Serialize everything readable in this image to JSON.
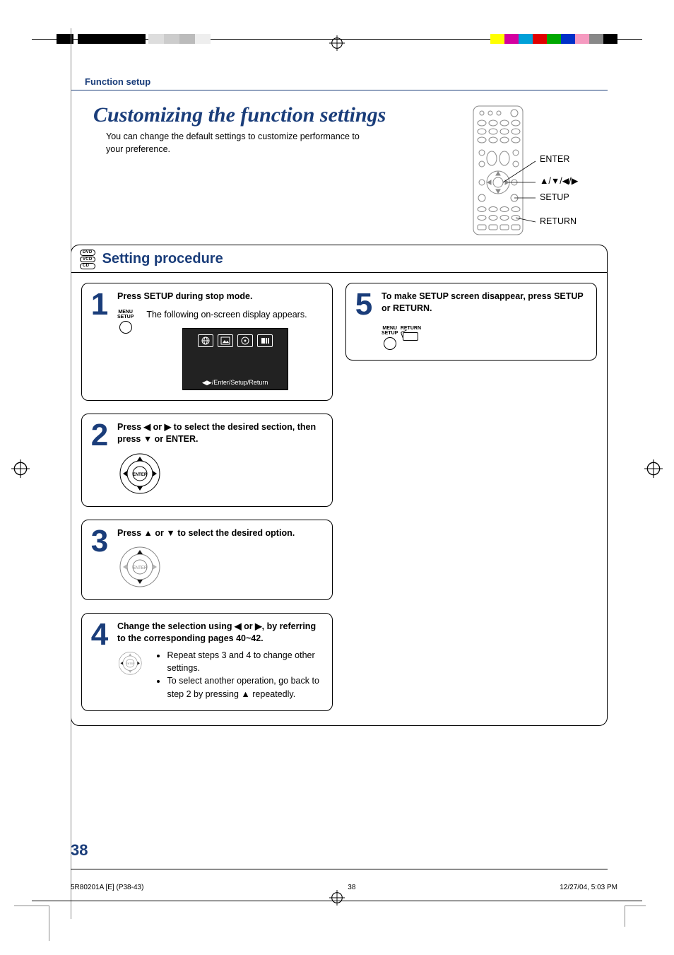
{
  "header": {
    "section_label": "Function setup"
  },
  "title": "Customizing the function settings",
  "subtitle": "You can change the default settings to customize performance to your preference.",
  "remote": {
    "labels": {
      "enter": "ENTER",
      "arrows": "▲/▼/◀/▶",
      "setup": "SETUP",
      "return": "RETURN"
    }
  },
  "disc_badges": [
    "DVD",
    "VCD",
    "CD"
  ],
  "procedure_title": "Setting procedure",
  "steps": {
    "s1": {
      "num": "1",
      "head": "Press SETUP during stop mode.",
      "text": "The following on-screen display appears.",
      "menu_label_1": "MENU",
      "menu_label_2": "SETUP",
      "osd_foot": "◀▶/Enter/Setup/Return"
    },
    "s2": {
      "num": "2",
      "head": "Press ◀ or ▶ to select the desired section, then press ▼ or ENTER."
    },
    "s3": {
      "num": "3",
      "head": "Press ▲ or ▼ to select the desired option."
    },
    "s4": {
      "num": "4",
      "head": "Change the selection using ◀ or ▶, by referring to the corresponding pages 40~42.",
      "bullet1": "Repeat steps 3 and 4 to change other settings.",
      "bullet2": "To select another operation, go back to step 2 by pressing ▲ repeatedly."
    },
    "s5": {
      "num": "5",
      "head": "To make SETUP screen disappear, press SETUP or RETURN.",
      "menu_label_1": "MENU",
      "menu_label_2": "SETUP",
      "return_label": "RETURN"
    }
  },
  "page_number": "38",
  "footer": {
    "left": "5R80201A [E] (P38-43)",
    "center": "38",
    "right": "12/27/04, 5:03 PM"
  }
}
